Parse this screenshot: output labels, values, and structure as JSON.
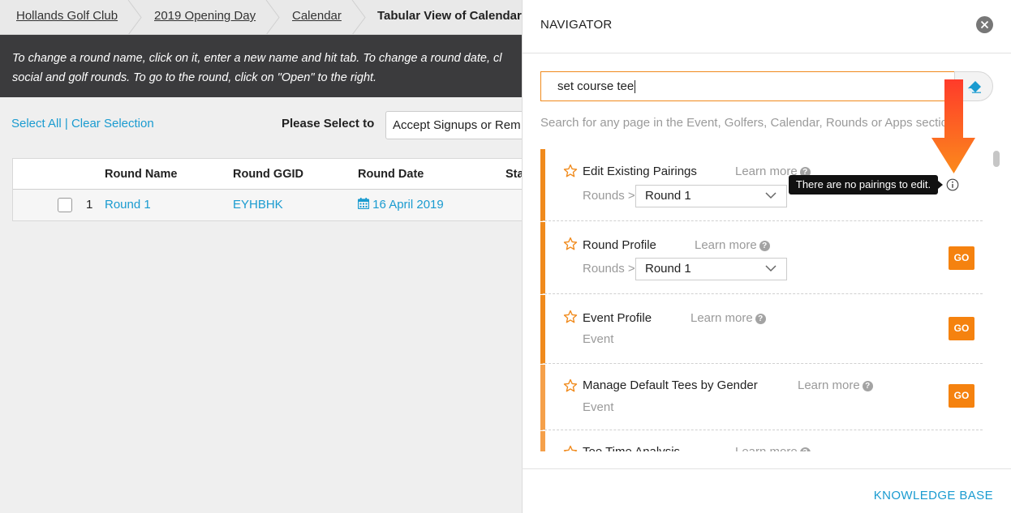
{
  "breadcrumb": {
    "items": [
      "Hollands Golf Club",
      "2019 Opening Day",
      "Calendar"
    ],
    "current": "Tabular View of Calendar"
  },
  "infobar": {
    "line1": "To change a round name, click on it, enter a new name and hit tab. To change a round date, cl",
    "line2": "social and golf rounds. To go to the round, click on \"Open\" to the right."
  },
  "toolbar": {
    "select_all": "Select All",
    "separator": "|",
    "clear_selection": "Clear Selection",
    "please_select_label": "Please Select to",
    "action_value": "Accept Signups or Rem"
  },
  "table": {
    "headers": [
      "Round Name",
      "Round GGID",
      "Round Date",
      "Sta"
    ],
    "rows": [
      {
        "index": "1",
        "name": "Round 1",
        "ggid": "EYHBHK",
        "date": "16 April 2019"
      }
    ]
  },
  "navigator": {
    "title": "NAVIGATOR",
    "search_value": "set course tee",
    "hint": "Search for any page in the Event, Golfers, Calendar, Rounds or Apps sections.",
    "learn_more": "Learn more",
    "results": [
      {
        "title": "Edit Existing Pairings",
        "breadcrumb": "Rounds >",
        "select_value": "Round 1",
        "tooltip": "There are no pairings to edit."
      },
      {
        "title": "Round Profile",
        "breadcrumb": "Rounds >",
        "select_value": "Round 1",
        "action": "GO"
      },
      {
        "title": "Event Profile",
        "subtitle": "Event",
        "action": "GO"
      },
      {
        "title": "Manage Default Tees by Gender",
        "subtitle": "Event",
        "action": "GO"
      },
      {
        "title": "Tee Time Analysis"
      }
    ],
    "footer_link": "KNOWLEDGE BASE"
  },
  "colors": {
    "accent": "#f08a1c",
    "go_button": "#f5820f",
    "link": "#1a9bd0",
    "infobar_bg": "#3b3b3d",
    "arrow": "#fb5a1e"
  }
}
